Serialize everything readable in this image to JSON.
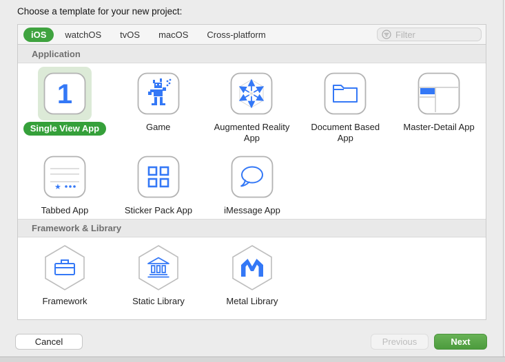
{
  "dialog": {
    "title": "Choose a template for your new project:"
  },
  "platform_tabs": {
    "items": [
      {
        "label": "iOS",
        "selected": true
      },
      {
        "label": "watchOS",
        "selected": false
      },
      {
        "label": "tvOS",
        "selected": false
      },
      {
        "label": "macOS",
        "selected": false
      },
      {
        "label": "Cross-platform",
        "selected": false
      }
    ]
  },
  "filter": {
    "placeholder": "Filter"
  },
  "sections": [
    {
      "title": "Application",
      "templates": [
        {
          "name": "Single View App",
          "selected": true,
          "icon": "single-view-app-icon"
        },
        {
          "name": "Game",
          "selected": false,
          "icon": "game-icon"
        },
        {
          "name": "Augmented Reality App",
          "selected": false,
          "icon": "augmented-reality-icon"
        },
        {
          "name": "Document Based App",
          "selected": false,
          "icon": "document-based-icon"
        },
        {
          "name": "Master-Detail App",
          "selected": false,
          "icon": "master-detail-icon"
        },
        {
          "name": "Tabbed App",
          "selected": false,
          "icon": "tabbed-app-icon"
        },
        {
          "name": "Sticker Pack App",
          "selected": false,
          "icon": "sticker-pack-icon"
        },
        {
          "name": "iMessage App",
          "selected": false,
          "icon": "imessage-app-icon"
        }
      ]
    },
    {
      "title": "Framework & Library",
      "templates": [
        {
          "name": "Framework",
          "selected": false,
          "icon": "framework-icon"
        },
        {
          "name": "Static Library",
          "selected": false,
          "icon": "static-library-icon"
        },
        {
          "name": "Metal Library",
          "selected": false,
          "icon": "metal-library-icon"
        }
      ]
    }
  ],
  "icon_glyphs": {
    "single_view_badge": "1",
    "tabbed_star": "★"
  },
  "footer": {
    "cancel_label": "Cancel",
    "previous_label": "Previous",
    "next_label": "Next"
  },
  "colors": {
    "accent_green": "#3fa33f",
    "selected_pill_green": "#35a03a",
    "selection_background": "#dcead7",
    "icon_blue": "#3478f6",
    "next_button_green": "#4c9b3d"
  }
}
